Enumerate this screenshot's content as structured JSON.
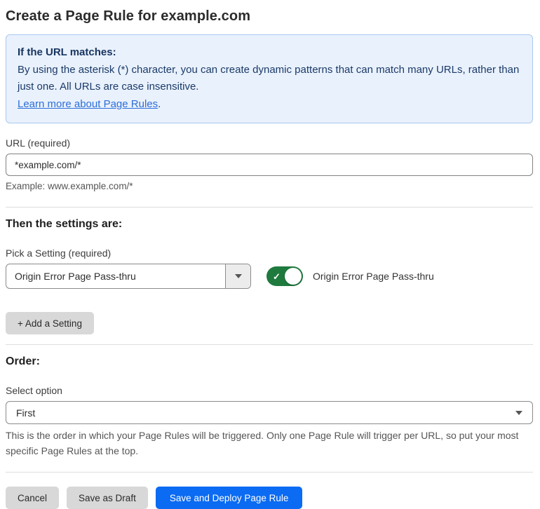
{
  "page": {
    "title": "Create a Page Rule for example.com"
  },
  "info_box": {
    "heading": "If the URL matches:",
    "body": "By using the asterisk (*) character, you can create dynamic patterns that can match many URLs, rather than just one. All URLs are case insensitive.",
    "link_label": "Learn more about Page Rules",
    "link_suffix": "."
  },
  "url_field": {
    "label": "URL (required)",
    "value": "*example.com/*",
    "helper": "Example: www.example.com/*"
  },
  "settings_section": {
    "heading": "Then the settings are:",
    "picker_label": "Pick a Setting (required)",
    "picker_value": "Origin Error Page Pass-thru",
    "toggle": {
      "state": "on",
      "check_glyph": "✓",
      "label": "Origin Error Page Pass-thru"
    },
    "add_setting_label": "+ Add a Setting"
  },
  "order_section": {
    "heading": "Order:",
    "select_label": "Select option",
    "select_value": "First",
    "helper": "This is the order in which your Page Rules will be triggered. Only one Page Rule will trigger per URL, so put your most specific Page Rules at the top."
  },
  "footer": {
    "cancel_label": "Cancel",
    "save_draft_label": "Save as Draft",
    "save_deploy_label": "Save and Deploy Page Rule"
  },
  "colors": {
    "info_bg": "#e9f1fc",
    "info_border": "#a9c8f2",
    "info_text": "#1b3a69",
    "link": "#2c6ed8",
    "toggle_on": "#1f7a3e",
    "primary_button": "#0b6bf2",
    "gray_button": "#d8d8d8"
  }
}
